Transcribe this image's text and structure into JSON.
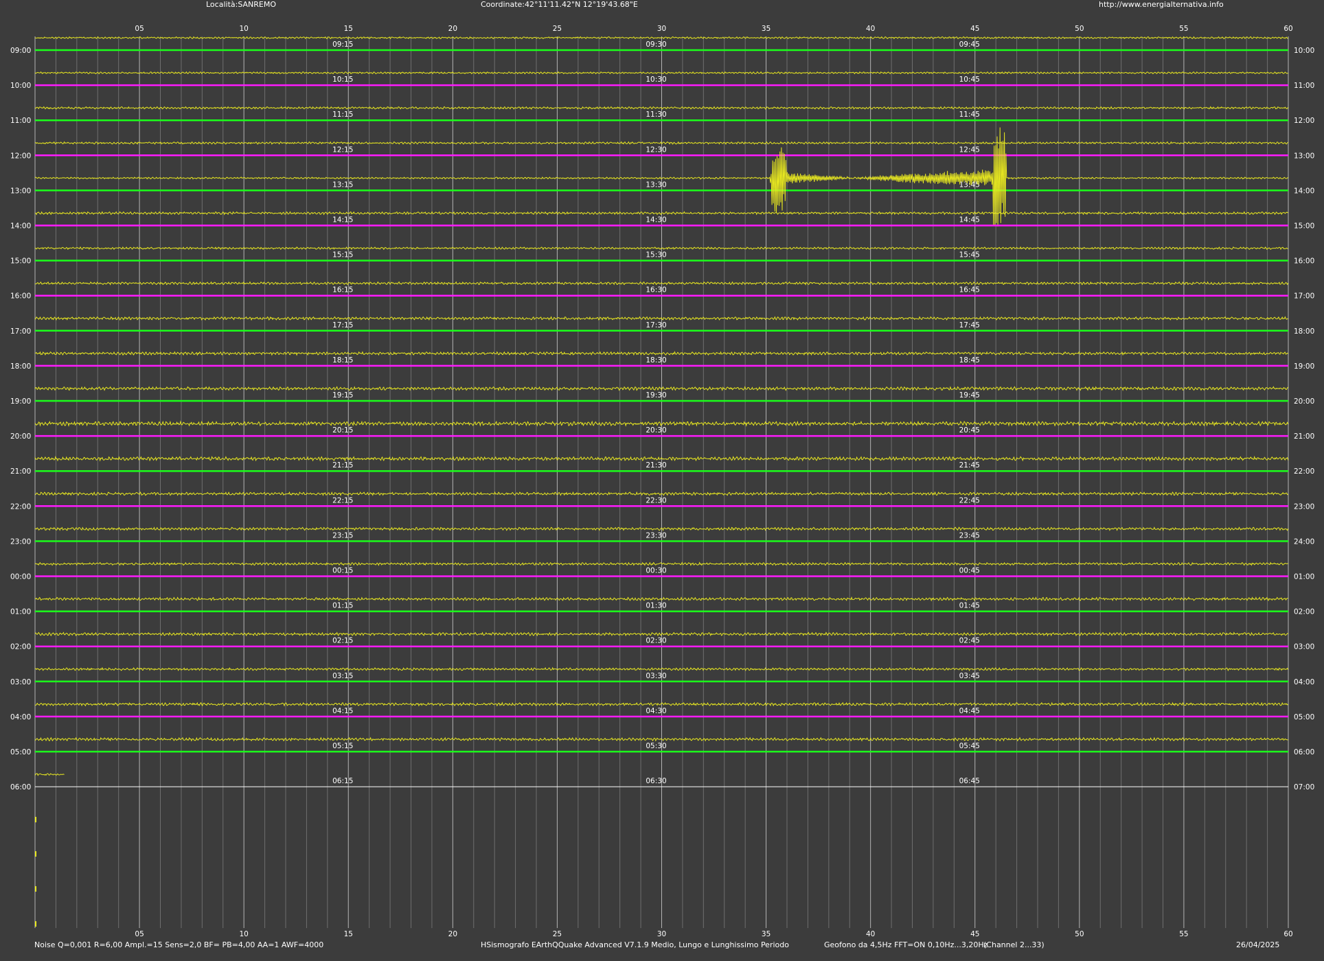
{
  "header": {
    "location": "Località:SANREMO",
    "coordinates": "Coordinate:42°11'11.42\"N  12°19'43.68\"E",
    "website": "http://www.energialternativa.info"
  },
  "footer": {
    "params": "Noise Q=0,001 R=6,00 Ampl.=15 Sens=2,0 BF= PB=4,00 AA=1 AWF=4000",
    "software": "HSismografo  EArthQQuake Advanced V7.1.9  Medio, Lungo e Lunghissimo Periodo",
    "sensor": "Geofono da 4,5Hz FFT=ON 0,10Hz...3,20Hz",
    "channel": "(Channel 2...33)",
    "date": "26/04/2025"
  },
  "colors": {
    "background": "#3c3c3c",
    "grid_major": "#b4b4b4",
    "grid_minor": "#6e6e6e",
    "trace": "#e8e820",
    "line_green": "#1aff1a",
    "line_magenta": "#ff1aff",
    "line_white": "#ffffff",
    "text": "#ffffff"
  },
  "chart_data": {
    "type": "line",
    "x_unit": "minutes",
    "xlim": [
      0,
      60
    ],
    "x_ticks": [
      "05",
      "10",
      "15",
      "20",
      "25",
      "30",
      "35",
      "40",
      "45",
      "50",
      "55",
      "60"
    ],
    "rows": [
      {
        "left": "09:00",
        "right": "10:00",
        "marks": [
          "09:15",
          "09:30",
          "09:45"
        ],
        "line": "green",
        "noise": 0.5
      },
      {
        "left": "10:00",
        "right": "11:00",
        "marks": [
          "10:15",
          "10:30",
          "10:45"
        ],
        "line": "magenta",
        "noise": 0.5
      },
      {
        "left": "11:00",
        "right": "12:00",
        "marks": [
          "11:15",
          "11:30",
          "11:45"
        ],
        "line": "green",
        "noise": 0.6
      },
      {
        "left": "12:00",
        "right": "13:00",
        "marks": [
          "12:15",
          "12:30",
          "12:45"
        ],
        "line": "magenta",
        "noise": 0.6
      },
      {
        "left": "13:00",
        "right": "14:00",
        "marks": [
          "13:15",
          "13:30",
          "13:45"
        ],
        "line": "green",
        "noise": 0.5
      },
      {
        "left": "14:00",
        "right": "15:00",
        "marks": [
          "14:15",
          "14:30",
          "14:45"
        ],
        "line": "magenta",
        "noise": 0.7
      },
      {
        "left": "15:00",
        "right": "16:00",
        "marks": [
          "15:15",
          "15:30",
          "15:45"
        ],
        "line": "green",
        "noise": 0.6
      },
      {
        "left": "16:00",
        "right": "17:00",
        "marks": [
          "16:15",
          "16:30",
          "16:45"
        ],
        "line": "magenta",
        "noise": 0.7
      },
      {
        "left": "17:00",
        "right": "18:00",
        "marks": [
          "17:15",
          "17:30",
          "17:45"
        ],
        "line": "green",
        "noise": 0.8
      },
      {
        "left": "18:00",
        "right": "19:00",
        "marks": [
          "18:15",
          "18:30",
          "18:45"
        ],
        "line": "magenta",
        "noise": 0.8
      },
      {
        "left": "19:00",
        "right": "20:00",
        "marks": [
          "19:15",
          "19:30",
          "19:45"
        ],
        "line": "green",
        "noise": 0.9
      },
      {
        "left": "20:00",
        "right": "21:00",
        "marks": [
          "20:15",
          "20:30",
          "20:45"
        ],
        "line": "magenta",
        "noise": 1.1
      },
      {
        "left": "21:00",
        "right": "22:00",
        "marks": [
          "21:15",
          "21:30",
          "21:45"
        ],
        "line": "green",
        "noise": 1.0
      },
      {
        "left": "22:00",
        "right": "23:00",
        "marks": [
          "22:15",
          "22:30",
          "22:45"
        ],
        "line": "magenta",
        "noise": 0.8
      },
      {
        "left": "23:00",
        "right": "24:00",
        "marks": [
          "23:15",
          "23:30",
          "23:45"
        ],
        "line": "green",
        "noise": 0.8
      },
      {
        "left": "00:00",
        "right": "01:00",
        "marks": [
          "00:15",
          "00:30",
          "00:45"
        ],
        "line": "magenta",
        "noise": 0.7
      },
      {
        "left": "01:00",
        "right": "02:00",
        "marks": [
          "01:15",
          "01:30",
          "01:45"
        ],
        "line": "green",
        "noise": 0.8
      },
      {
        "left": "02:00",
        "right": "03:00",
        "marks": [
          "02:15",
          "02:30",
          "02:45"
        ],
        "line": "magenta",
        "noise": 0.8
      },
      {
        "left": "03:00",
        "right": "04:00",
        "marks": [
          "03:15",
          "03:30",
          "03:45"
        ],
        "line": "green",
        "noise": 0.7
      },
      {
        "left": "04:00",
        "right": "05:00",
        "marks": [
          "04:15",
          "04:30",
          "04:45"
        ],
        "line": "magenta",
        "noise": 0.8
      },
      {
        "left": "05:00",
        "right": "06:00",
        "marks": [
          "05:15",
          "05:30",
          "05:45"
        ],
        "line": "green",
        "noise": 0.8
      },
      {
        "left": "06:00",
        "right": "07:00",
        "marks": [
          "06:15",
          "06:30",
          "06:45"
        ],
        "line": "white",
        "noise": 0.6,
        "trace_end_minute": 1.4
      }
    ],
    "events": [
      {
        "start_hour": "13:00",
        "start_minute": 35.2,
        "end_minute": 46.5,
        "peak_minute": 35.6,
        "second_peak_minute": 46.2,
        "description": "earthquake"
      }
    ]
  }
}
